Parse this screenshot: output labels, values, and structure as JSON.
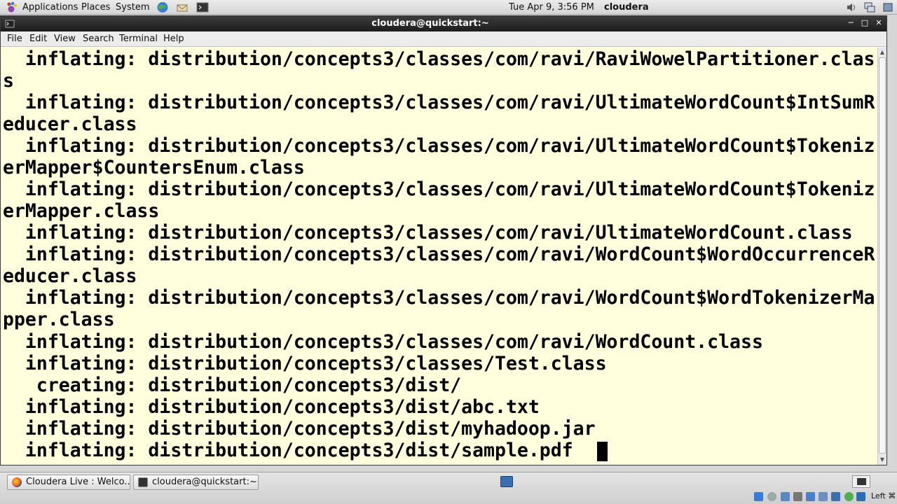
{
  "top_panel": {
    "menus": [
      "Applications",
      "Places",
      "System"
    ],
    "clock": "Tue Apr  9,  3:56 PM",
    "user": "cloudera"
  },
  "window": {
    "title": "cloudera@quickstart:~",
    "menu": [
      "File",
      "Edit",
      "View",
      "Search",
      "Terminal",
      "Help"
    ]
  },
  "terminal": {
    "lines": [
      "  inflating: distribution/concepts3/classes/com/ravi/RaviWowelPartitioner.clas",
      "s",
      "  inflating: distribution/concepts3/classes/com/ravi/UltimateWordCount$IntSumR",
      "educer.class",
      "  inflating: distribution/concepts3/classes/com/ravi/UltimateWordCount$Tokeniz",
      "erMapper$CountersEnum.class",
      "  inflating: distribution/concepts3/classes/com/ravi/UltimateWordCount$Tokeniz",
      "erMapper.class",
      "  inflating: distribution/concepts3/classes/com/ravi/UltimateWordCount.class",
      "  inflating: distribution/concepts3/classes/com/ravi/WordCount$WordOccurrenceR",
      "educer.class",
      "  inflating: distribution/concepts3/classes/com/ravi/WordCount$WordTokenizerMa",
      "pper.class",
      "  inflating: distribution/concepts3/classes/com/ravi/WordCount.class",
      "  inflating: distribution/concepts3/classes/Test.class",
      "   creating: distribution/concepts3/dist/",
      "  inflating: distribution/concepts3/dist/abc.txt",
      "  inflating: distribution/concepts3/dist/myhadoop.jar",
      "  inflating: distribution/concepts3/dist/sample.pdf  "
    ]
  },
  "taskbar": {
    "tasks": [
      "Cloudera Live : Welco...",
      "cloudera@quickstart:~"
    ],
    "keyboard_label": "Left ⌘"
  },
  "colors": {
    "terminal_bg": "#fffedd",
    "titlebar_bg": "#2a2a2a"
  }
}
